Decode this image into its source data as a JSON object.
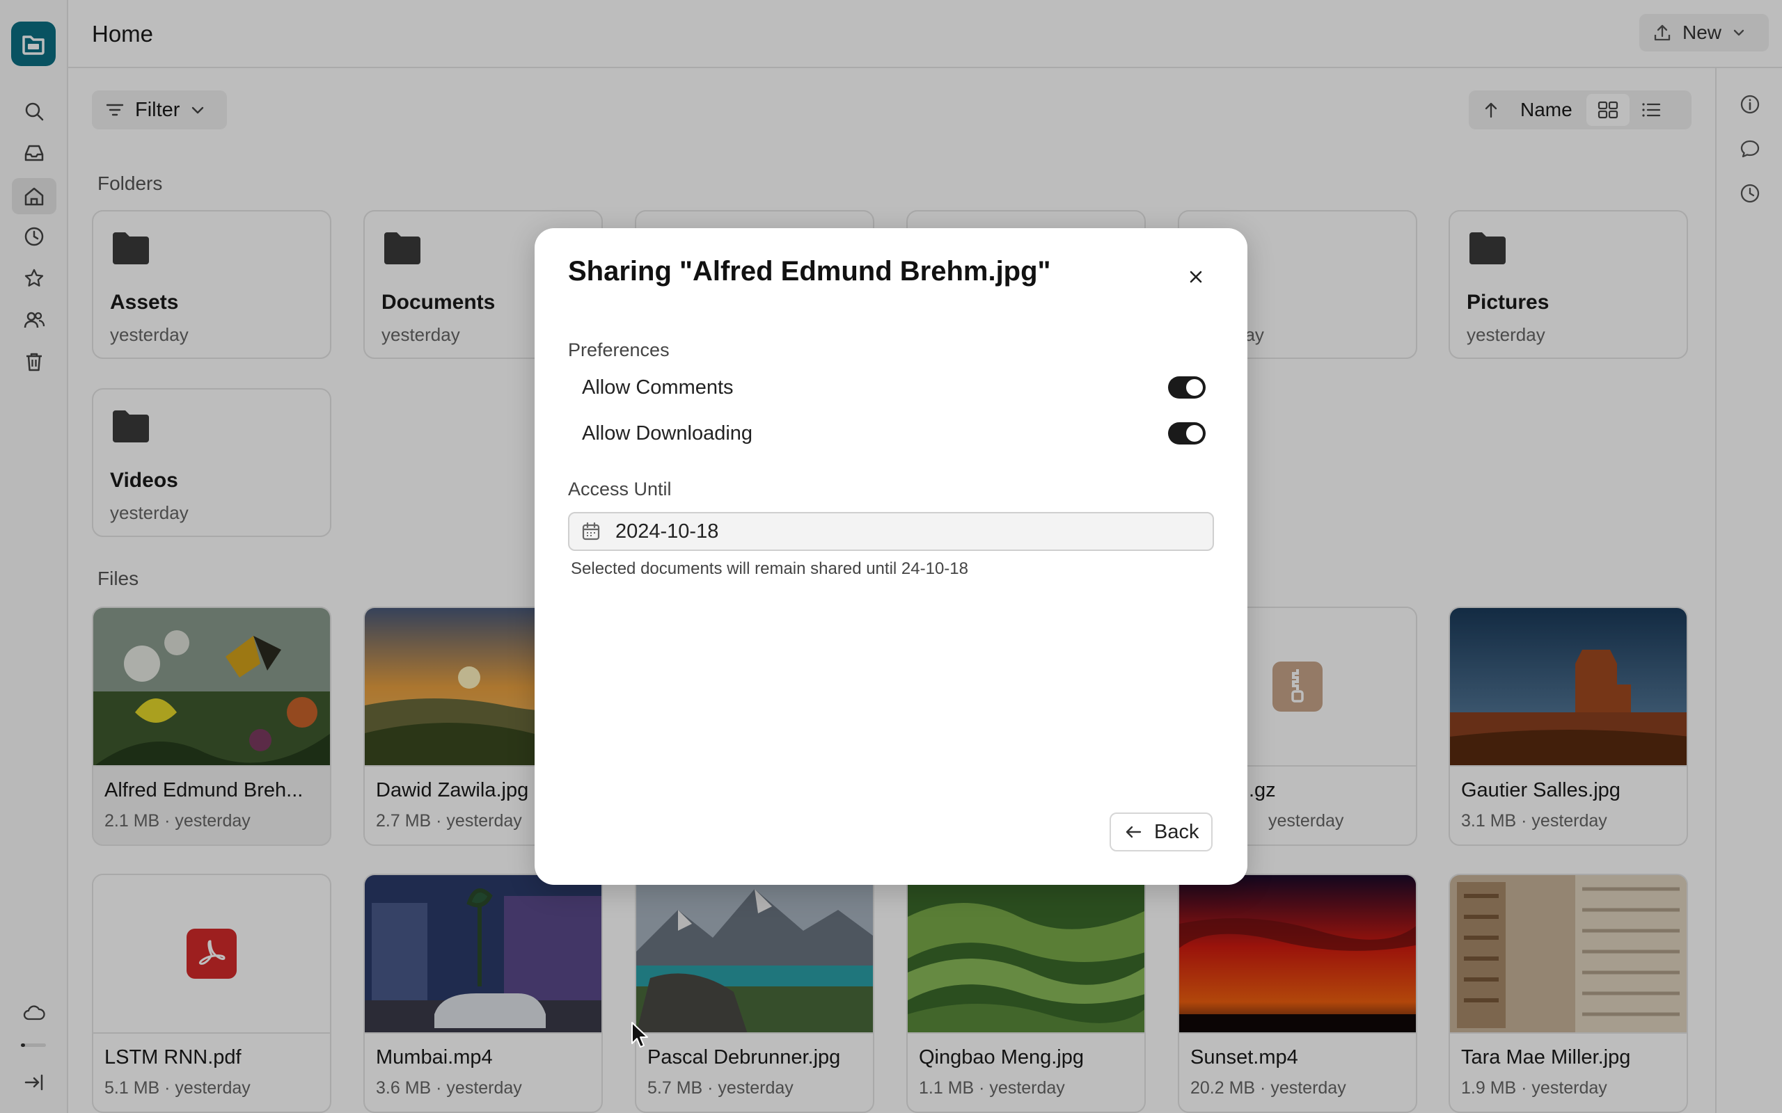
{
  "app": {
    "page_title": "Home",
    "new_button": "New",
    "brand_color": "#0b6f84"
  },
  "sidebar": {
    "items": [
      {
        "icon": "search-icon"
      },
      {
        "icon": "inbox-icon"
      },
      {
        "icon": "home-icon",
        "active": true
      },
      {
        "icon": "clock-icon"
      },
      {
        "icon": "star-icon"
      },
      {
        "icon": "users-icon"
      },
      {
        "icon": "trash-icon"
      }
    ],
    "bottom": [
      {
        "icon": "cloud-icon"
      },
      {
        "icon": "logout-icon"
      }
    ]
  },
  "right_rail": {
    "items": [
      {
        "icon": "info-icon"
      },
      {
        "icon": "comment-icon"
      },
      {
        "icon": "history-icon"
      }
    ]
  },
  "toolbar": {
    "filter_label": "Filter",
    "sort_label": "Name"
  },
  "folders_label": "Folders",
  "files_label": "Files",
  "folders": [
    {
      "name": "Assets",
      "date": "yesterday"
    },
    {
      "name": "Documents",
      "date": "yesterday"
    },
    {
      "name": "",
      "date": ""
    },
    {
      "name": "",
      "date": ""
    },
    {
      "name": "",
      "date": "day"
    },
    {
      "name": "Pictures",
      "date": "yesterday"
    },
    {
      "name": "Videos",
      "date": "yesterday"
    }
  ],
  "files": [
    {
      "name": "Alfred Edmund Breh...",
      "size": "2.1 MB",
      "date": "yesterday"
    },
    {
      "name": "Dawid Zawila.jpg",
      "size": "2.7 MB",
      "date": "yesterday"
    },
    {
      "name": "",
      "size": "",
      "date": ""
    },
    {
      "name": "",
      "size": "",
      "date": ""
    },
    {
      "name": ".gz",
      "size": "",
      "date": "yesterday"
    },
    {
      "name": "Gautier Salles.jpg",
      "size": "3.1 MB",
      "date": "yesterday"
    },
    {
      "name": "LSTM RNN.pdf",
      "size": "5.1 MB",
      "date": "yesterday"
    },
    {
      "name": "Mumbai.mp4",
      "size": "3.6 MB",
      "date": "yesterday"
    },
    {
      "name": "Pascal Debrunner.jpg",
      "size": "5.7 MB",
      "date": "yesterday"
    },
    {
      "name": "Qingbao Meng.jpg",
      "size": "1.1 MB",
      "date": "yesterday"
    },
    {
      "name": "Sunset.mp4",
      "size": "20.2 MB",
      "date": "yesterday"
    },
    {
      "name": "Tara Mae Miller.jpg",
      "size": "1.9 MB",
      "date": "yesterday"
    }
  ],
  "dialog": {
    "title": "Sharing \"Alfred Edmund Brehm.jpg\"",
    "preferences_label": "Preferences",
    "allow_comments": {
      "label": "Allow Comments",
      "on": true
    },
    "allow_downloading": {
      "label": "Allow Downloading",
      "on": true
    },
    "access_until_label": "Access Until",
    "date_value": "2024-10-18",
    "helper_text": "Selected documents will remain shared until 24-10-18",
    "back_label": "Back"
  }
}
